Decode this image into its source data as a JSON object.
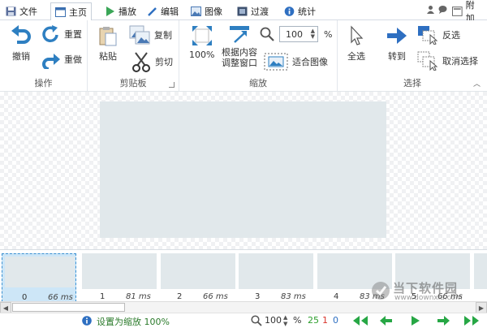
{
  "menu": {
    "file": "文件",
    "home": "主页",
    "play": "播放",
    "edit": "编辑",
    "image": "图像",
    "transition": "过渡",
    "stats": "统计",
    "addon": "附加"
  },
  "ribbon": {
    "undo": "撤销",
    "redo": "重置",
    "repeat": "重做",
    "group_ops": "操作",
    "paste": "粘贴",
    "copy": "复制",
    "cut": "剪切",
    "group_clipboard": "剪贴板",
    "zoom100": "100%",
    "fit_content_1": "根据内容",
    "fit_content_2": "调整窗口",
    "zoom_value": "100",
    "zoom_unit": "%",
    "fit_image": "适合图像",
    "group_zoom": "缩放",
    "select_all": "全选",
    "goto": "转到",
    "invert": "反选",
    "deselect": "取消选择",
    "group_select": "选择"
  },
  "frames": [
    {
      "index": "0",
      "ms": "66 ms"
    },
    {
      "index": "1",
      "ms": "81 ms"
    },
    {
      "index": "2",
      "ms": "66 ms"
    },
    {
      "index": "3",
      "ms": "83 ms"
    },
    {
      "index": "4",
      "ms": "83 ms"
    },
    {
      "index": "5",
      "ms": "66 ms"
    }
  ],
  "status": {
    "message": "设置为缩放 100%",
    "zoom": "100",
    "zoom_unit": "%",
    "count_total": "25",
    "count_selected": "1",
    "count_index": "0"
  },
  "watermark": {
    "brand": "当下软件园",
    "url": "www.downxia.com"
  },
  "colors": {
    "accent": "#2e7fc1",
    "canvas": "#e1e8eb",
    "nav_green": "#27a745",
    "count_green": "#2a9d2a",
    "count_red": "#d9342b",
    "count_blue": "#2e6fc1"
  }
}
